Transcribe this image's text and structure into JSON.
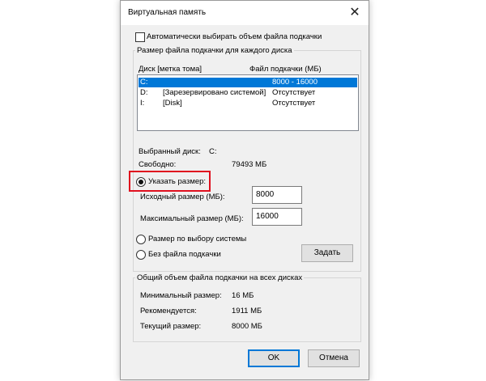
{
  "window": {
    "title": "Виртуальная память",
    "close_glyph": "✕"
  },
  "auto_manage": {
    "label": "Автоматически выбирать объем файла подкачки",
    "checked": false
  },
  "per_drive_group": {
    "title": "Размер файла подкачки для каждого диска",
    "columns": [
      "Диск [метка тома]",
      "Файл подкачки (МБ)"
    ],
    "drives": [
      {
        "drive": "C:",
        "label": "",
        "size": "8000 - 16000",
        "selected": true
      },
      {
        "drive": "D:",
        "label": "[Зарезервировано системой]",
        "size": "Отсутствует",
        "selected": false
      },
      {
        "drive": "I:",
        "label": "[Disk]",
        "size": "Отсутствует",
        "selected": false
      }
    ],
    "selected_drive_label": "Выбранный диск:",
    "selected_drive_value": "C:",
    "free_label": "Свободно:",
    "free_value": "79493 МБ",
    "custom_size_label": "Указать размер:",
    "initial_size_label": "Исходный размер (МБ):",
    "initial_size_value": "8000",
    "max_size_label": "Максимальный размер (МБ):",
    "max_size_value": "16000",
    "system_managed_label": "Размер по выбору системы",
    "no_paging_label": "Без файла подкачки",
    "set_button": "Задать"
  },
  "total_group": {
    "title": "Общий объем файла подкачки на всех дисках",
    "min_label": "Минимальный размер:",
    "min_value": "16 МБ",
    "recommended_label": "Рекомендуется:",
    "recommended_value": "1911 МБ",
    "current_label": "Текущий размер:",
    "current_value": "8000 МБ"
  },
  "footer": {
    "ok": "OK",
    "cancel": "Отмена"
  },
  "colors": {
    "selection": "#0078d7",
    "highlight_box": "#e0101e"
  }
}
